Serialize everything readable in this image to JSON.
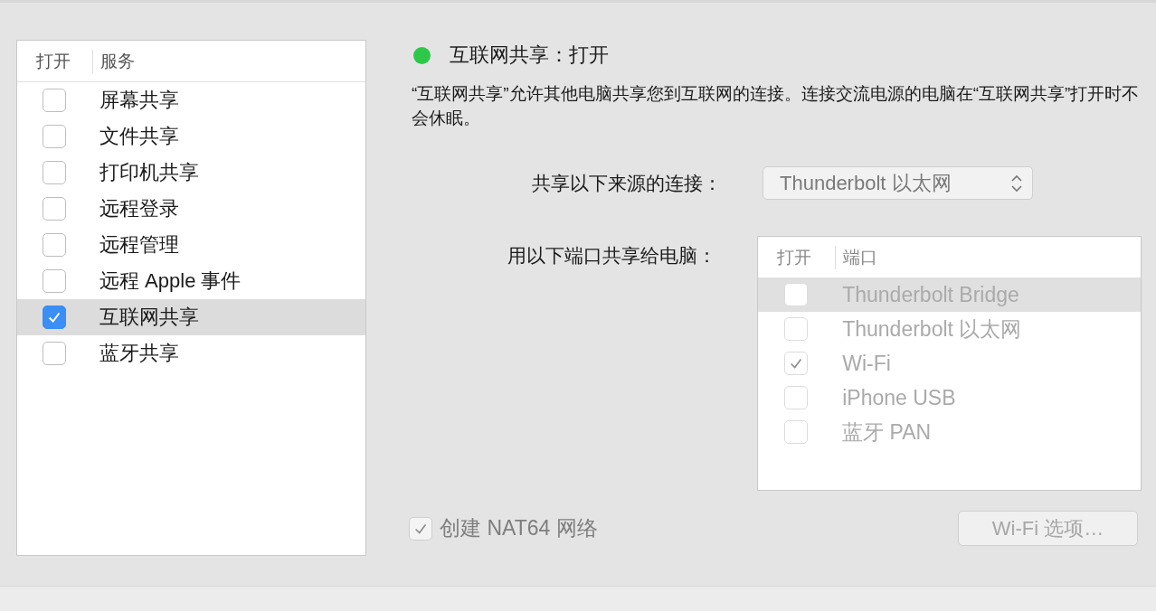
{
  "services": {
    "columns": [
      "打开",
      "服务"
    ],
    "items": [
      {
        "name": "屏幕共享",
        "checked": false,
        "selected": false
      },
      {
        "name": "文件共享",
        "checked": false,
        "selected": false
      },
      {
        "name": "打印机共享",
        "checked": false,
        "selected": false
      },
      {
        "name": "远程登录",
        "checked": false,
        "selected": false
      },
      {
        "name": "远程管理",
        "checked": false,
        "selected": false
      },
      {
        "name": "远程 Apple 事件",
        "checked": false,
        "selected": false
      },
      {
        "name": "互联网共享",
        "checked": true,
        "selected": true
      },
      {
        "name": "蓝牙共享",
        "checked": false,
        "selected": false
      }
    ]
  },
  "detail": {
    "status": {
      "title": "互联网共享：打开",
      "on": true
    },
    "description": "“互联网共享”允许其他电脑共享您到互联网的连接。连接交流电源的电脑在“互联网共享”打开时不会休眠。",
    "source": {
      "label": "共享以下来源的连接：",
      "value": "Thunderbolt 以太网"
    },
    "ports": {
      "label": "用以下端口共享给电脑：",
      "disabled": true,
      "columns": [
        "打开",
        "端口"
      ],
      "items": [
        {
          "name": "Thunderbolt Bridge",
          "checked": false,
          "selected": true
        },
        {
          "name": "Thunderbolt 以太网",
          "checked": false,
          "selected": false
        },
        {
          "name": "Wi-Fi",
          "checked": true,
          "selected": false
        },
        {
          "name": "iPhone USB",
          "checked": false,
          "selected": false
        },
        {
          "name": "蓝牙 PAN",
          "checked": false,
          "selected": false
        }
      ]
    },
    "nat64": {
      "label": "创建 NAT64 网络",
      "checked": true,
      "disabled": true
    },
    "wifi_button": {
      "label": "Wi-Fi 选项…",
      "disabled": true
    }
  }
}
